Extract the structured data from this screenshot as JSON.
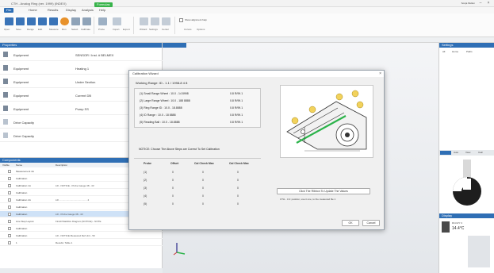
{
  "titlebar": {
    "title": "CTH - Analog Ring (ver. 1999) (INDEX)",
    "account": "Sonja Mullen"
  },
  "tabs": [
    {
      "label": "File"
    },
    {
      "label": "Home"
    },
    {
      "label": "Results"
    },
    {
      "label": "Display"
    },
    {
      "label": "Analysis"
    },
    {
      "label": "Help"
    },
    {
      "label": "Formulas"
    }
  ],
  "ribbon": {
    "labels": [
      "Open",
      "Save",
      "Range",
      "Edit",
      "Measure",
      "Run",
      "Select",
      "Calibrate",
      "Probe",
      "Import",
      "Export",
      "Wizard",
      "Settings",
      "Center",
      "Curves",
      "Options"
    ],
    "checkbox_label": "Show alignment help"
  },
  "left_top": {
    "header": "Properties",
    "rows": [
      {
        "key": "Equipment",
        "value": "SENSOR / Inst. # BELMEX"
      },
      {
        "key": "Equipment",
        "value": "Heating 1"
      },
      {
        "key": "Equipment",
        "value": "Under Section"
      },
      {
        "key": "Equipment",
        "value": "Current DB"
      },
      {
        "key": "Equipment",
        "value": "Pump SS"
      },
      {
        "key": "Drive Capacity",
        "value": ""
      },
      {
        "key": "Drive Capacity",
        "value": ""
      }
    ]
  },
  "left_bottom": {
    "header": "Components",
    "columns": [
      "Visible",
      "Name",
      "Description"
    ],
    "rows": [
      {
        "name": "Measurement 4A",
        "desc": ""
      },
      {
        "name": "Calibration",
        "desc": ""
      },
      {
        "name": "Calibration 1A",
        "desc": "LR  - NOTICE  - Probe Gauge 38  - 43"
      },
      {
        "name": "Calibration",
        "desc": ""
      },
      {
        "name": "Calibration 2A",
        "desc": "LR  ..........................................  4"
      },
      {
        "name": "Calibration",
        "desc": ""
      },
      {
        "name": "Calibration",
        "desc": "LR  - Probe Gauge 38  - 43",
        "selected": true
      },
      {
        "name": "Line Step Layout",
        "desc": "Finish/Stabilize Diagram  (NOTICE) - NOTE"
      },
      {
        "name": "Calibration",
        "desc": ""
      },
      {
        "name": "Calibration",
        "desc": "LR  - NOTICE  Measured Ref Unit  - 50"
      },
      {
        "name": "1",
        "desc": "Results: Table 1"
      }
    ]
  },
  "dialog": {
    "title": "Calibration Wizard",
    "working_range": "Working Range: ID - 1.1 / 1998-8 4 8",
    "ranges": [
      {
        "label": "(1) Small Range Wheel : 10.0 - 14 8998",
        "status": "0.8 R/99.1"
      },
      {
        "label": "(2) Large Range Wheel : 10.0 - 188 8888",
        "status": "0.8 R/99.1"
      },
      {
        "label": "(3) Ring Range ID : 10.0 - 18.8888",
        "status": "0.8 R/99.1"
      },
      {
        "label": "(4) ID Range : 10.0 - 18 8888",
        "status": "0.8 R/99.1"
      },
      {
        "label": "(5) Reading Ball : 10.0 - 18.8888",
        "status": "0.8 R/99.1"
      }
    ],
    "notice": "NOTICE: Choose The Above Steps are Correct To Set Calibration",
    "table_headers": [
      "Probe",
      "Offset",
      "Cal Check Max",
      "Cal Check Max"
    ],
    "table_rows": [
      [
        "(1)",
        "0",
        "0",
        "0"
      ],
      [
        "(2)",
        "0",
        "0",
        "0"
      ],
      [
        "(3)",
        "0",
        "0",
        "0"
      ],
      [
        "(4)",
        "0",
        "0",
        "0"
      ],
      [
        "(5)",
        "0",
        "0",
        "0"
      ]
    ],
    "action_button": "Click The Ribbon To Update The Values",
    "hint": "CTH - 3.4: position, use it one, to the measured file 1",
    "ok_label": "OK",
    "cancel_label": "Cancel"
  },
  "right_top": {
    "header": "Settings",
    "items": [
      "All",
      "Home",
      "Paths"
    ]
  },
  "right_mid": {
    "tabs": [
      "Auto",
      "View",
      "Calc"
    ]
  },
  "right_bot": {
    "header": "Display",
    "values": [
      "R/4 R/Y 3",
      "14.4°C"
    ]
  }
}
